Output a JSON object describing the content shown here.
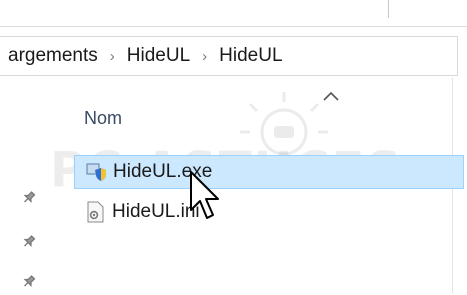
{
  "breadcrumb": {
    "items": [
      "argements",
      "HideUL",
      "HideUL"
    ],
    "separator": "›"
  },
  "file_list": {
    "column_header": "Nom",
    "sort_direction": "ascending",
    "rows": [
      {
        "name": "HideUL.exe",
        "icon": "exe-shield-icon",
        "selected": true
      },
      {
        "name": "HideUL.ini",
        "icon": "settings-file-icon",
        "selected": false
      }
    ]
  },
  "quick_access": {
    "pin_glyph": "📌"
  },
  "watermark": {
    "text": "PC ASTUCES"
  },
  "colors": {
    "selection_bg": "#cce8ff",
    "selection_border": "#99d1ff",
    "header_text": "#3a4a63"
  }
}
